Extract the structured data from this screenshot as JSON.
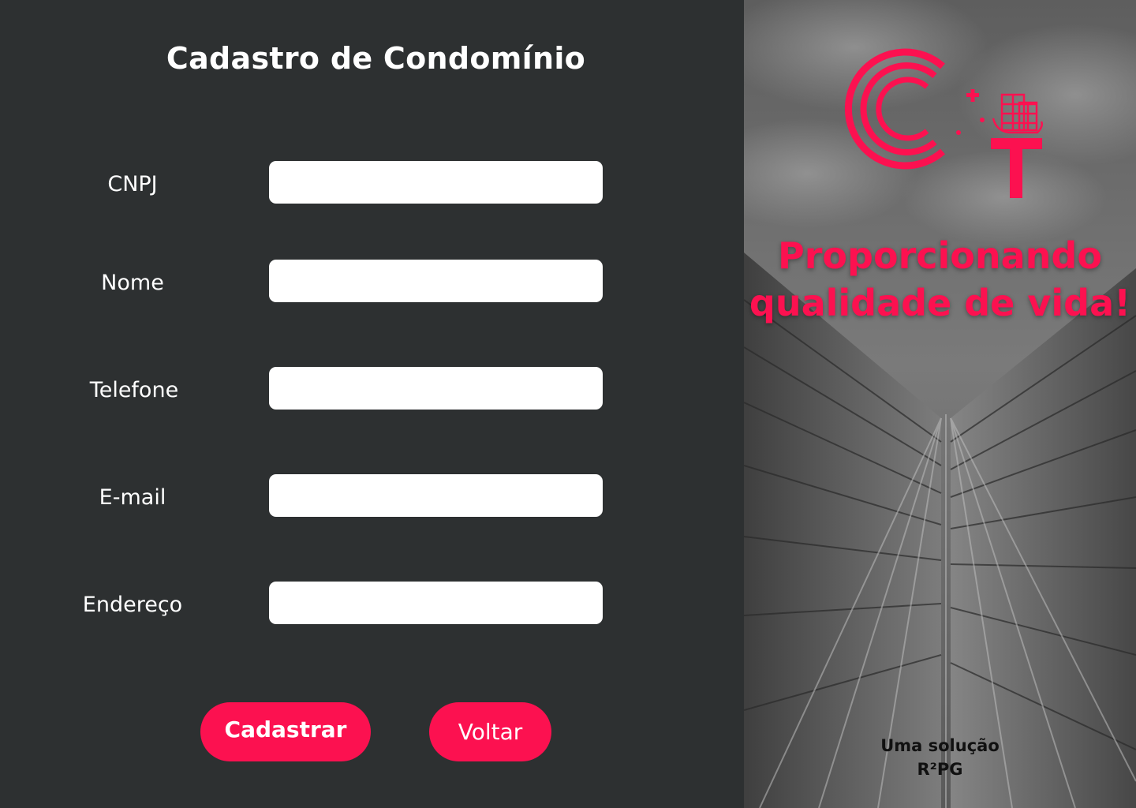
{
  "form": {
    "title": "Cadastro de Condomínio",
    "fields": [
      {
        "label": "CNPJ",
        "value": ""
      },
      {
        "label": "Nome",
        "value": ""
      },
      {
        "label": "Telefone",
        "value": ""
      },
      {
        "label": "E-mail",
        "value": ""
      },
      {
        "label": "Endereço",
        "value": ""
      }
    ],
    "submit_label": "Cadastrar",
    "back_label": "Voltar"
  },
  "aside": {
    "logo_icon": "condominium-logo-icon",
    "tagline": "Proporcionando qualidade de vida!",
    "credit_line1": "Uma solução",
    "credit_line2": "R²PG"
  },
  "colors": {
    "accent": "#fc1150",
    "panel_background": "#2d3031",
    "input_background": "#ffffff"
  }
}
